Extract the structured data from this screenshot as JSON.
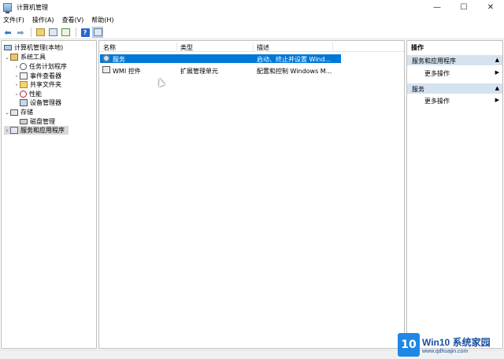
{
  "window": {
    "title": "计算机管理",
    "controls": {
      "minimize": "—",
      "maximize": "☐",
      "close": "✕"
    }
  },
  "menu": [
    "文件(F)",
    "操作(A)",
    "查看(V)",
    "帮助(H)"
  ],
  "toolbar": {
    "back_icon": "left-arrow-icon",
    "forward_icon": "right-arrow-icon",
    "up_icon": "up-folder-icon",
    "console_icon": "console-tree-icon",
    "export_icon": "export-list-icon",
    "help_label": "?",
    "properties_icon": "properties-icon"
  },
  "tree": {
    "root": "计算机管理(本地)",
    "system_tools": "系统工具",
    "task_scheduler": "任务计划程序",
    "event_viewer": "事件查看器",
    "shared_folders": "共享文件夹",
    "performance": "性能",
    "device_manager": "设备管理器",
    "storage": "存储",
    "disk_management": "磁盘管理",
    "services_apps": "服务和应用程序",
    "expand_open": "⌄",
    "expand_closed": "›"
  },
  "list": {
    "columns": {
      "name": "名称",
      "type": "类型",
      "description": "描述"
    },
    "rows": [
      {
        "name": "服务",
        "type": "",
        "description": "启动、终止并设置 Wind..."
      },
      {
        "name": "WMI 控件",
        "type": "扩展管理单元",
        "description": "配置和控制 Windows M..."
      }
    ]
  },
  "actions": {
    "title": "操作",
    "group1": "服务和应用程序",
    "group1_item": "更多操作",
    "group2": "服务",
    "group2_item": "更多操作",
    "collapse_glyph": "▲",
    "more_glyph": "▶"
  },
  "watermark": {
    "badge": "10",
    "main": "Win10 系统家园",
    "sub": "www.qdhuajin.com"
  }
}
